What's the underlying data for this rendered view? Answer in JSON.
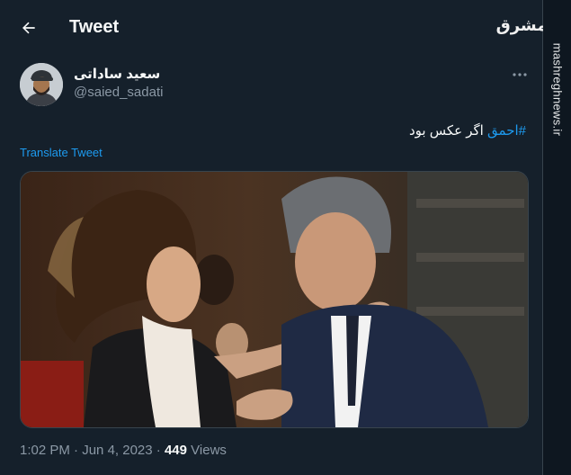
{
  "header": {
    "title": "Tweet",
    "back_icon": "arrow-left-icon"
  },
  "watermark": {
    "site": "mashreghnews.ir",
    "logo_text": "مشرق"
  },
  "author": {
    "name": "سعید ساداتی",
    "handle": "@saied_sadati"
  },
  "tweet": {
    "hashtag": "#احمق",
    "text": " اگر عکس بود"
  },
  "translate_label": "Translate Tweet",
  "meta": {
    "time": "1:02 PM",
    "sep1": " · ",
    "date": "Jun 4, 2023",
    "sep2": " · ",
    "views_count": "449",
    "views_label": " Views"
  },
  "colors": {
    "background": "#15202b",
    "accent": "#1d9bf0",
    "secondary_text": "#8b98a5"
  }
}
